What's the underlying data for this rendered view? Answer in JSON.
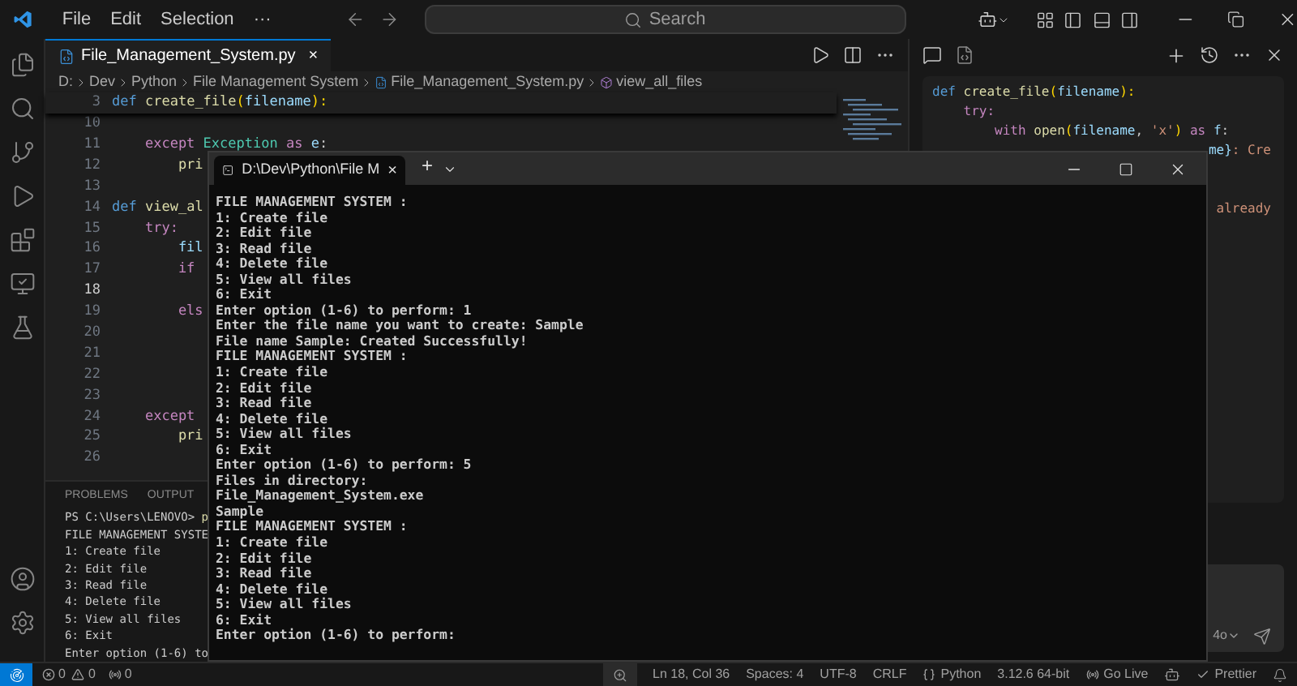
{
  "title_bar": {
    "menu": [
      "File",
      "Edit",
      "Selection",
      "···"
    ],
    "search": {
      "placeholder": "Search"
    }
  },
  "editor": {
    "tab": {
      "label": "File_Management_System.py",
      "close": "×"
    },
    "breadcrumbs": [
      "D:",
      "Dev",
      "Python",
      "File Management System",
      "File_Management_System.py",
      "view_all_files"
    ],
    "sticky_line": {
      "number": "3",
      "tokens": [
        {
          "text": "def ",
          "kind": "def"
        },
        {
          "text": "create_file",
          "kind": "fn"
        },
        {
          "text": "(",
          "kind": "bracket"
        },
        {
          "text": "filename",
          "kind": "param"
        },
        {
          "text": "):",
          "kind": "bracket"
        }
      ]
    },
    "lines": [
      {
        "number": "10",
        "selected": false
      },
      {
        "number": "11",
        "selected": false,
        "tokens": [
          {
            "text": "    except ",
            "kind": "kw"
          },
          {
            "text": "Exception",
            "kind": "cls"
          },
          {
            "text": " as ",
            "kind": "kw"
          },
          {
            "text": "e",
            "kind": "param"
          },
          {
            "text": ":",
            "kind": "plain"
          }
        ]
      },
      {
        "number": "12",
        "selected": false,
        "tokens": [
          {
            "text": "        pri",
            "kind": "fn"
          }
        ]
      },
      {
        "number": "13",
        "selected": false
      },
      {
        "number": "14",
        "selected": false,
        "tokens": [
          {
            "text": "def ",
            "kind": "def"
          },
          {
            "text": "view_al",
            "kind": "fn"
          }
        ]
      },
      {
        "number": "15",
        "selected": false,
        "tokens": [
          {
            "text": "    try:",
            "kind": "kw"
          }
        ]
      },
      {
        "number": "16",
        "selected": false,
        "tokens": [
          {
            "text": "        fil",
            "kind": "param"
          }
        ]
      },
      {
        "number": "17",
        "selected": false,
        "tokens": [
          {
            "text": "        if",
            "kind": "kw"
          }
        ]
      },
      {
        "number": "18",
        "selected": true
      },
      {
        "number": "19",
        "selected": false,
        "tokens": [
          {
            "text": "        els",
            "kind": "kw"
          }
        ]
      },
      {
        "number": "20",
        "selected": false
      },
      {
        "number": "21",
        "selected": false
      },
      {
        "number": "22",
        "selected": false
      },
      {
        "number": "23",
        "selected": false
      },
      {
        "number": "24",
        "selected": false,
        "tokens": [
          {
            "text": "    except",
            "kind": "kw"
          }
        ]
      },
      {
        "number": "25",
        "selected": false,
        "tokens": [
          {
            "text": "        pri",
            "kind": "fn"
          }
        ]
      },
      {
        "number": "26",
        "selected": false
      }
    ]
  },
  "panel": {
    "tabs": [
      {
        "label": "PROBLEMS",
        "selected": false
      },
      {
        "label": "OUTPUT",
        "selected": false
      }
    ],
    "prompt": "PS C:\\Users\\LENOVO>",
    "command": "p",
    "terminal_lines": [
      "FILE MANAGEMENT SYSTE",
      "1: Create file",
      "2: Edit file",
      "3: Read file",
      "4: Delete file",
      "5: View all files",
      "6: Exit",
      "Enter option (1-6) to"
    ]
  },
  "chat": {
    "code_lines": [
      {
        "kind": "line",
        "tokens": [
          {
            "text": "def ",
            "kind": "def"
          },
          {
            "text": "create_file",
            "kind": "fn"
          },
          {
            "text": "(",
            "kind": "bracket"
          },
          {
            "text": "filename",
            "kind": "param"
          },
          {
            "text": "):",
            "kind": "bracket"
          }
        ]
      },
      {
        "kind": "line",
        "tokens": [
          {
            "text": "    try:",
            "kind": "kw"
          }
        ]
      },
      {
        "kind": "line",
        "tokens": [
          {
            "text": "        with ",
            "kind": "kw"
          },
          {
            "text": "open",
            "kind": "fn"
          },
          {
            "text": "(",
            "kind": "bracket"
          },
          {
            "text": "filename",
            "kind": "param"
          },
          {
            "text": ", ",
            "kind": "plain"
          },
          {
            "text": "'x'",
            "kind": "str"
          },
          {
            "text": ") ",
            "kind": "bracket"
          },
          {
            "text": "as ",
            "kind": "kw"
          },
          {
            "text": "f",
            "kind": "param"
          },
          {
            "text": ":",
            "kind": "plain"
          }
        ]
      },
      {
        "kind": "fragment",
        "tokens": [
          {
            "text": "me}",
            "kind": "param"
          },
          {
            "text": ": Cre",
            "kind": "str"
          }
        ]
      },
      {
        "kind": "gap"
      },
      {
        "kind": "gap"
      },
      {
        "kind": "fragment",
        "tokens": [
          {
            "text": "already",
            "kind": "str"
          }
        ]
      }
    ],
    "model": "4o"
  },
  "console": {
    "title": "D:\\Dev\\Python\\File M",
    "close_tab": "×",
    "new_tab": "+",
    "lines": [
      "FILE MANAGEMENT SYSTEM :",
      "1: Create file",
      "2: Edit file",
      "3: Read file",
      "4: Delete file",
      "5: View all files",
      "6: Exit",
      "Enter option (1-6) to perform: 1",
      "Enter the file name you want to create: Sample",
      "File name Sample: Created Successfully!",
      "FILE MANAGEMENT SYSTEM :",
      "1: Create file",
      "2: Edit file",
      "3: Read file",
      "4: Delete file",
      "5: View all files",
      "6: Exit",
      "Enter option (1-6) to perform: 5",
      "Files in directory:",
      "File_Management_System.exe",
      "Sample",
      "FILE MANAGEMENT SYSTEM :",
      "1: Create file",
      "2: Edit file",
      "3: Read file",
      "4: Delete file",
      "5: View all files",
      "6: Exit",
      "Enter option (1-6) to perform:"
    ]
  },
  "status_bar": {
    "errors": "0",
    "warnings": "0",
    "ports": "0",
    "items": [
      {
        "kind": "zoom"
      },
      {
        "kind": "text",
        "label": "Ln 18, Col 36"
      },
      {
        "kind": "text",
        "label": "Spaces: 4"
      },
      {
        "kind": "text",
        "label": "UTF-8"
      },
      {
        "kind": "text",
        "label": "CRLF"
      },
      {
        "kind": "language",
        "label": "Python"
      },
      {
        "kind": "text",
        "label": "3.12.6 64-bit"
      },
      {
        "kind": "live",
        "label": "Go Live"
      },
      {
        "kind": "copilot"
      },
      {
        "kind": "prettier",
        "label": "Prettier"
      },
      {
        "kind": "bell"
      }
    ]
  }
}
